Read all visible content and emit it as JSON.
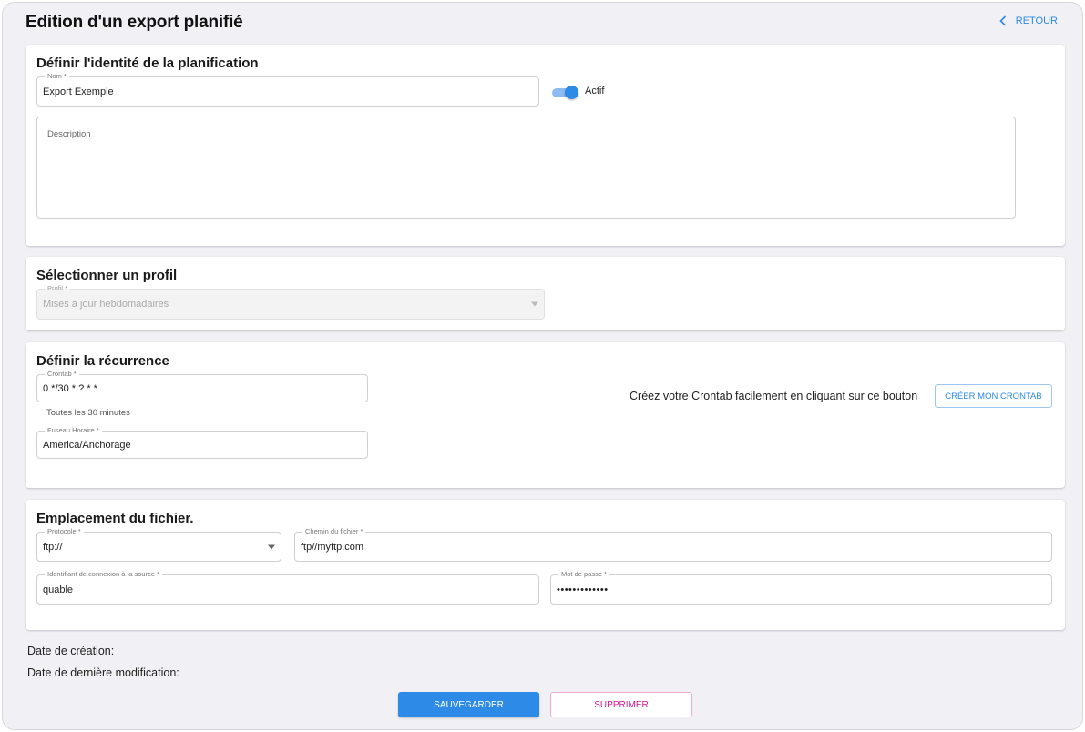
{
  "header": {
    "title": "Edition d'un export planifié",
    "back_label": "RETOUR"
  },
  "identity": {
    "title": "Définir l'identité de la planification",
    "name_label": "Nom *",
    "name_value": "Export Exemple",
    "active_label": "Actif",
    "active": true,
    "description_placeholder": "Description"
  },
  "profile": {
    "title": "Sélectionner un profil",
    "profile_label": "Profil *",
    "profile_value": "Mises à jour hebdomadaires"
  },
  "recurrence": {
    "title": "Définir la récurrence",
    "crontab_label": "Crontab *",
    "crontab_value": "0 */30 * ? * *",
    "crontab_helper": "Toutes les 30 minutes",
    "timezone_label": "Fuseau Horaire *",
    "timezone_value": "America/Anchorage",
    "builder_text": "Créez votre Crontab facilement en cliquant sur ce bouton",
    "builder_button": "CRÉER MON CRONTAB"
  },
  "location": {
    "title": "Emplacement du fichier.",
    "protocol_label": "Protocole *",
    "protocol_value": "ftp://",
    "path_label": "Chemin du fichier *",
    "path_value": "ftp//myftp.com",
    "login_label": "Identifiant de connexion à la source *",
    "login_value": "quable",
    "password_label": "Mot de passe *",
    "password_value": "•••••••••••••"
  },
  "meta": {
    "created_label": "Date de création:",
    "modified_label": "Date de dernière modification:"
  },
  "actions": {
    "save_label": "SAUVEGARDER",
    "delete_label": "SUPPRIMER"
  },
  "colors": {
    "accent": "#2d8ae6",
    "danger": "#d21a90",
    "background": "#f1f1f5"
  }
}
